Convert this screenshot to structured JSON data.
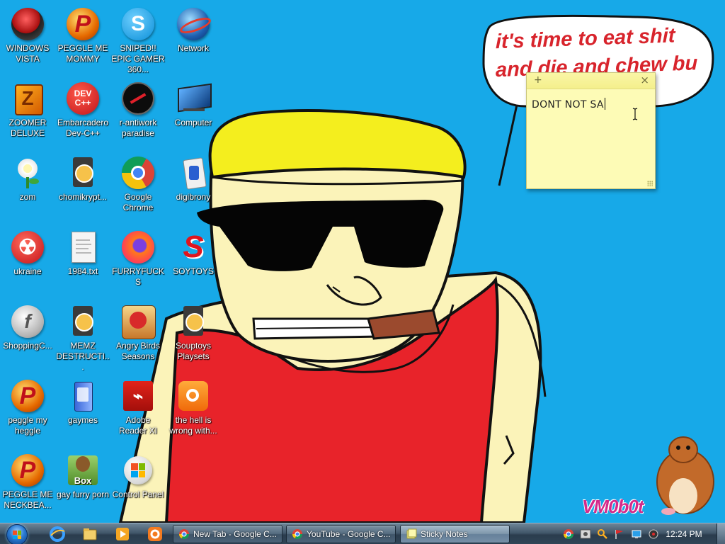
{
  "wallpaper": {
    "speech_bubble_text": "it's time to eat shit and die and chew bu",
    "signature": "VM0b0t"
  },
  "desktop": {
    "icons": [
      {
        "label": "WINDOWS VISTA",
        "icon": "windows-vista-icon"
      },
      {
        "label": "PEGGLE ME MOMMY",
        "icon": "peggle-icon"
      },
      {
        "label": "SNIPED!! EPIC GAMER 360...",
        "icon": "skype-icon"
      },
      {
        "label": "Network",
        "icon": "network-icon"
      },
      {
        "label": "ZOOMER DELUXE",
        "icon": "zoomer-deluxe-icon"
      },
      {
        "label": "Embarcadero Dev-C++",
        "icon": "dev-cpp-icon"
      },
      {
        "label": "r-antiwork paradise",
        "icon": "r-antiwork-icon"
      },
      {
        "label": "Computer",
        "icon": "computer-icon"
      },
      {
        "label": "zom",
        "icon": "plant-icon"
      },
      {
        "label": "chomikrypt...",
        "icon": "shortcut-clock-icon"
      },
      {
        "label": "Google Chrome",
        "icon": "chrome-icon"
      },
      {
        "label": "digibrony",
        "icon": "digibrony-icon"
      },
      {
        "label": "ukraine",
        "icon": "radiation-icon"
      },
      {
        "label": "1984.txt",
        "icon": "text-file-icon"
      },
      {
        "label": "FURRYFUCKS",
        "icon": "firefox-icon"
      },
      {
        "label": "SOYTOYS",
        "icon": "soytoys-icon"
      },
      {
        "label": "ShoppingC...",
        "icon": "flash-icon"
      },
      {
        "label": "MEMZ DESTRUCTI...",
        "icon": "shortcut-clock-icon"
      },
      {
        "label": "Angry Birds Seasons",
        "icon": "angry-birds-icon"
      },
      {
        "label": "Souptoys Playsets",
        "icon": "shortcut-clock-icon"
      },
      {
        "label": "peggle my heggle",
        "icon": "peggle-icon"
      },
      {
        "label": "gaymes",
        "icon": "games-folder-icon"
      },
      {
        "label": "Adobe Reader XI",
        "icon": "adobe-reader-icon"
      },
      {
        "label": "the hell is wrong with...",
        "icon": "uc-browser-icon"
      },
      {
        "label": "PEGGLE ME NECKBEA...",
        "icon": "peggle-icon"
      },
      {
        "label": "gay furry porn",
        "icon": "box-icon"
      },
      {
        "label": "Control Panel",
        "icon": "control-panel-icon"
      }
    ]
  },
  "sticky_note": {
    "text": "DONT NOT SA",
    "add_icon": "+",
    "close_icon": "×"
  },
  "taskbar": {
    "tasks": [
      {
        "label": "New Tab - Google C...",
        "icon": "chrome-icon",
        "active": false
      },
      {
        "label": "YouTube - Google C...",
        "icon": "chrome-icon",
        "active": false
      },
      {
        "label": "Sticky Notes",
        "icon": "sticky-notes-icon",
        "active": true
      }
    ],
    "clock": "12:24 PM"
  }
}
